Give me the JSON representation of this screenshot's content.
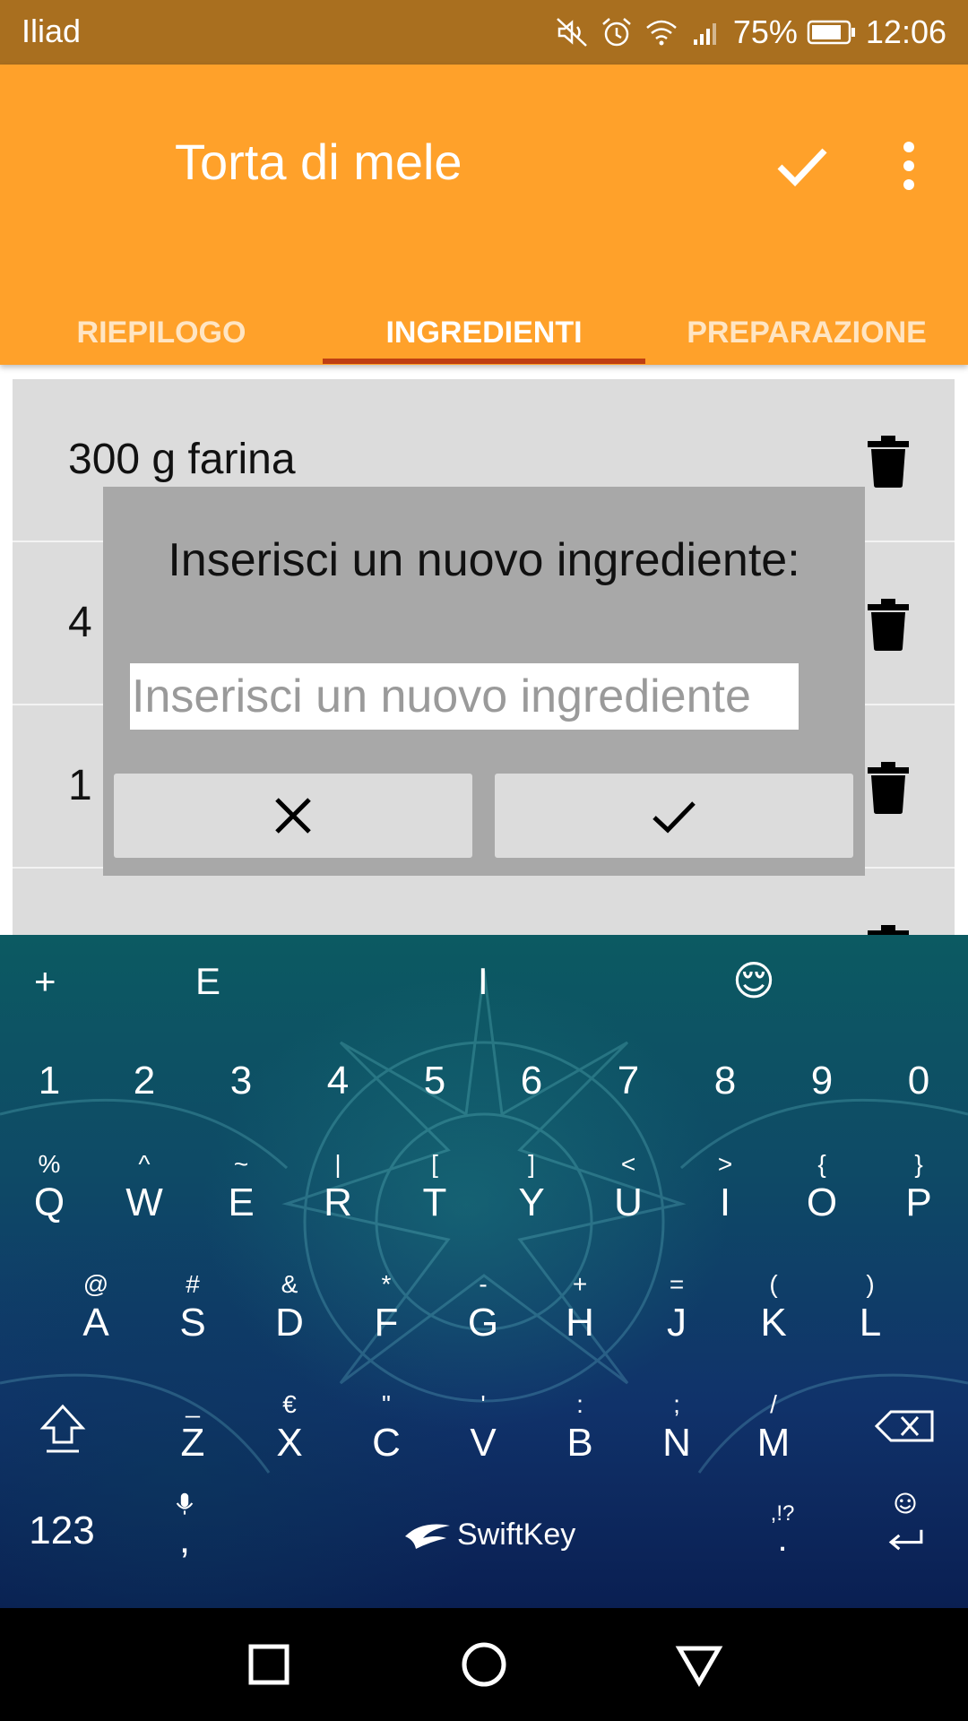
{
  "status_bar": {
    "carrier": "Iliad",
    "battery_percent": "75%",
    "time": "12:06",
    "icons": [
      "mute-icon",
      "alarm-icon",
      "wifi-icon",
      "signal-icon",
      "battery-icon"
    ]
  },
  "app_bar": {
    "title": "Torta di mele",
    "confirm_icon": "check-icon",
    "menu_icon": "more-vert-icon",
    "background": "#FFA12A"
  },
  "tabs": [
    {
      "label": "RIEPILOGO",
      "active": false
    },
    {
      "label": "INGREDIENTI",
      "active": true
    },
    {
      "label": "PREPARAZIONE",
      "active": false
    }
  ],
  "ingredients": [
    {
      "text": "300 g farina"
    },
    {
      "text": "4"
    },
    {
      "text": "1"
    },
    {
      "text": ""
    }
  ],
  "dialog": {
    "title": "Inserisci un nuovo ingrediente:",
    "input_value": "",
    "input_placeholder": "Inserisci un nuovo ingrediente",
    "cancel_icon": "close-icon",
    "confirm_icon": "check-icon"
  },
  "keyboard": {
    "brand": "SwiftKey",
    "predictions": [
      "E",
      "I"
    ],
    "emoji_prediction": "😌",
    "number_row": [
      "1",
      "2",
      "3",
      "4",
      "5",
      "6",
      "7",
      "8",
      "9",
      "0"
    ],
    "row1": [
      {
        "main": "Q",
        "sec": "%"
      },
      {
        "main": "W",
        "sec": "^"
      },
      {
        "main": "E",
        "sec": "~"
      },
      {
        "main": "R",
        "sec": "|"
      },
      {
        "main": "T",
        "sec": "["
      },
      {
        "main": "Y",
        "sec": "]"
      },
      {
        "main": "U",
        "sec": "<"
      },
      {
        "main": "I",
        "sec": ">"
      },
      {
        "main": "O",
        "sec": "{"
      },
      {
        "main": "P",
        "sec": "}"
      }
    ],
    "row2": [
      {
        "main": "A",
        "sec": "@"
      },
      {
        "main": "S",
        "sec": "#"
      },
      {
        "main": "D",
        "sec": "&"
      },
      {
        "main": "F",
        "sec": "*"
      },
      {
        "main": "G",
        "sec": "-"
      },
      {
        "main": "H",
        "sec": "+"
      },
      {
        "main": "J",
        "sec": "="
      },
      {
        "main": "K",
        "sec": "("
      },
      {
        "main": "L",
        "sec": ")"
      }
    ],
    "row3": [
      {
        "main": "Z",
        "sec": "_"
      },
      {
        "main": "X",
        "sec": "€"
      },
      {
        "main": "C",
        "sec": "\""
      },
      {
        "main": "V",
        "sec": "'"
      },
      {
        "main": "B",
        "sec": ":"
      },
      {
        "main": "N",
        "sec": ";"
      },
      {
        "main": "M",
        "sec": "/"
      }
    ],
    "numbers_key": "123",
    "comma": ",",
    "period": ".",
    "punct_hint": ",!?",
    "plus_key": "+"
  },
  "nav_bar": {
    "icons": [
      "recents-icon",
      "home-icon",
      "back-icon"
    ]
  }
}
